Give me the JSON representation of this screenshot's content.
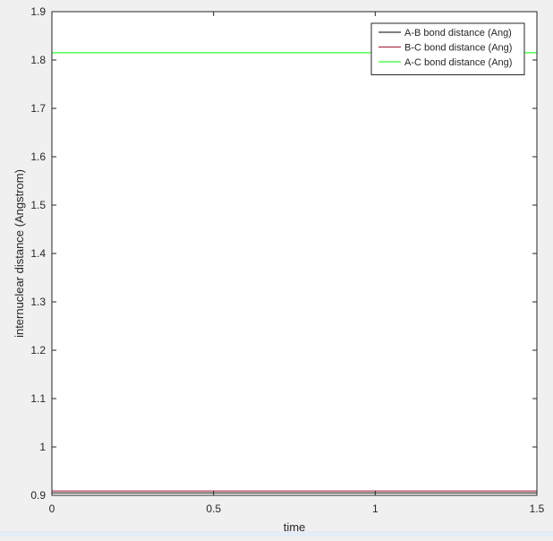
{
  "chart_data": {
    "type": "line",
    "title": "",
    "xlabel": "time",
    "ylabel": "internuclear distance (Angstrom)",
    "xlim": [
      0,
      1.5
    ],
    "ylim": [
      0.9,
      1.9
    ],
    "xticks": [
      0,
      0.5,
      1,
      1.5
    ],
    "xtick_labels": [
      "0",
      "0.5",
      "1",
      "1.5"
    ],
    "yticks": [
      0.9,
      1.0,
      1.1,
      1.2,
      1.3,
      1.4,
      1.5,
      1.6,
      1.7,
      1.8,
      1.9
    ],
    "ytick_labels": [
      "0.9",
      "1",
      "1.1",
      "1.2",
      "1.3",
      "1.4",
      "1.5",
      "1.6",
      "1.7",
      "1.8",
      "1.9"
    ],
    "grid": false,
    "legend_position": "top-right",
    "series": [
      {
        "name": "A-B bond distance (Ang)",
        "color": "#000000",
        "x": [
          0,
          1.5
        ],
        "y": [
          0.905,
          0.905
        ]
      },
      {
        "name": "B-C bond distance (Ang)",
        "color": "#a2142f",
        "x": [
          0,
          1.5
        ],
        "y": [
          0.909,
          0.909
        ]
      },
      {
        "name": "A-C bond distance (Ang)",
        "color": "#00ff00",
        "x": [
          0,
          1.5
        ],
        "y": [
          1.815,
          1.815
        ]
      }
    ]
  }
}
